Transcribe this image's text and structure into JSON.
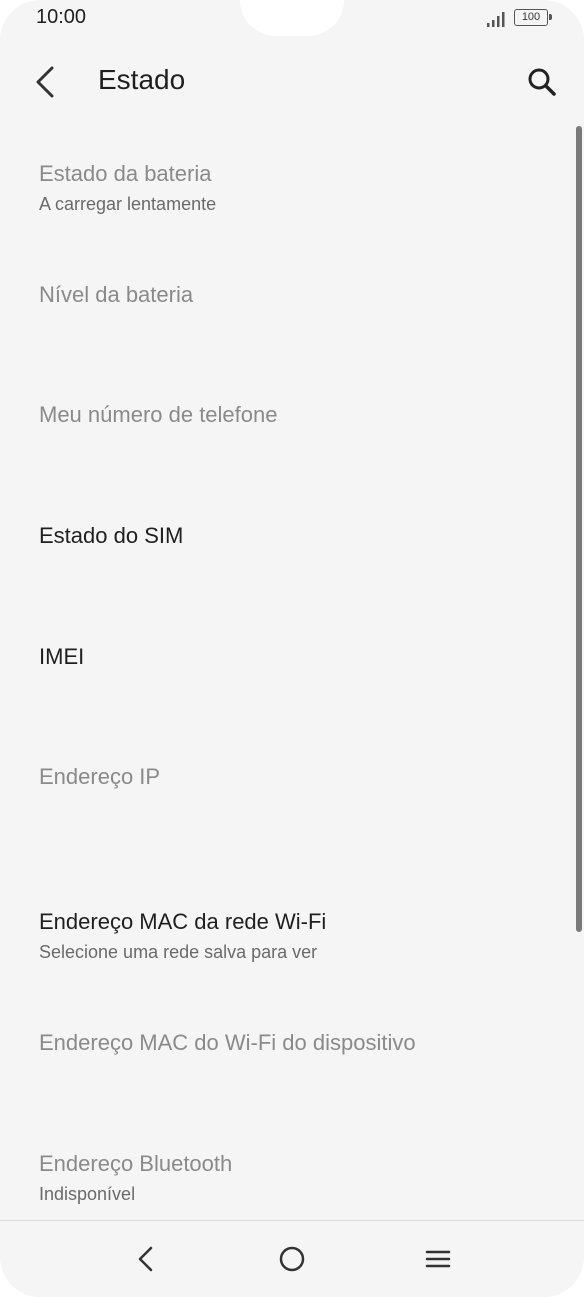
{
  "status_bar": {
    "time": "10:00",
    "battery": "100"
  },
  "header": {
    "title": "Estado"
  },
  "items": [
    {
      "title": "Estado da bateria",
      "subtitle": "A carregar lentamente"
    },
    {
      "title": "Nível da bateria",
      "subtitle": ""
    },
    {
      "title": "Meu número de telefone",
      "subtitle": ""
    },
    {
      "title": "Estado do SIM",
      "subtitle": ""
    },
    {
      "title": "IMEI",
      "subtitle": ""
    },
    {
      "title": "Endereço IP",
      "subtitle": ""
    },
    {
      "title": "Endereço MAC da rede Wi-Fi",
      "subtitle": "Selecione uma rede salva para ver"
    },
    {
      "title": "Endereço MAC do Wi-Fi do dispositivo",
      "subtitle": ""
    },
    {
      "title": "Endereço Bluetooth",
      "subtitle": "Indisponível"
    }
  ],
  "icons": {
    "back": "back-arrow-icon",
    "search": "search-icon",
    "nav_back": "nav-back-icon",
    "nav_home": "nav-home-icon",
    "nav_menu": "nav-menu-icon"
  }
}
